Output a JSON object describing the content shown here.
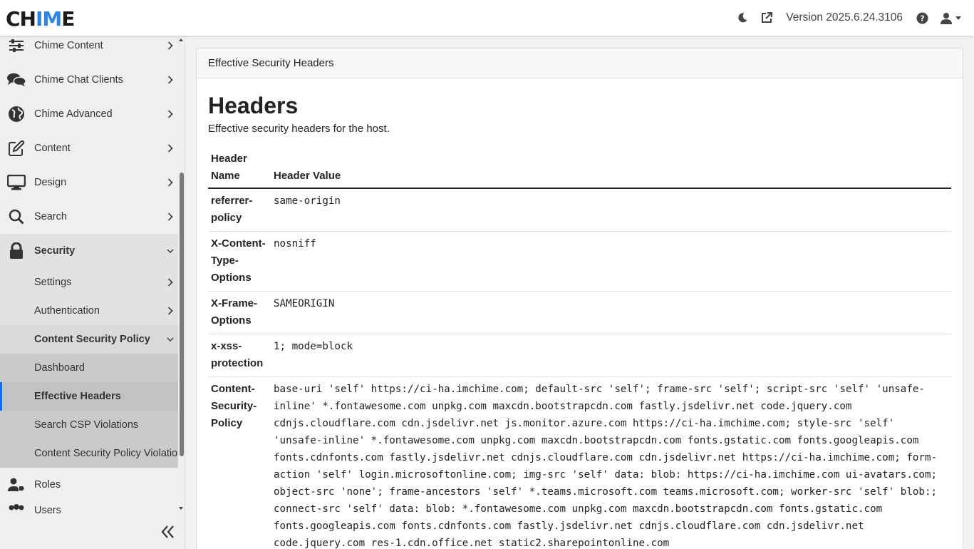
{
  "app": {
    "logo_text_1": "CH",
    "logo_text_accent": "IM",
    "logo_text_2": "E",
    "version": "Version 2025.6.24.3106",
    "icons": [
      "moon-icon",
      "external-link-icon",
      "question-icon",
      "user-icon"
    ]
  },
  "sidebar": {
    "items": [
      {
        "label": "Chime Content",
        "icon": "sliders-icon"
      },
      {
        "label": "Chime Chat Clients",
        "icon": "comments-icon"
      },
      {
        "label": "Chime Advanced",
        "icon": "globe-icon"
      },
      {
        "label": "Content",
        "icon": "edit-icon"
      },
      {
        "label": "Design",
        "icon": "desktop-icon"
      },
      {
        "label": "Search",
        "icon": "search-icon"
      },
      {
        "label": "Security",
        "icon": "lock-icon"
      },
      {
        "label": "Settings"
      },
      {
        "label": "Authentication"
      },
      {
        "label": "Content Security Policy"
      },
      {
        "label": "Dashboard"
      },
      {
        "label": "Effective Headers"
      },
      {
        "label": "Search CSP Violations"
      },
      {
        "label": "Content Security Policy Violation"
      },
      {
        "label": "Roles",
        "icon": "user-tag-icon"
      },
      {
        "label": "Users",
        "icon": "users-icon"
      }
    ]
  },
  "main": {
    "card_title": "Effective Security Headers",
    "heading": "Headers",
    "subtitle": "Effective security headers for the host.",
    "table": {
      "columns": [
        "Header Name",
        "Header Value"
      ],
      "rows": [
        {
          "name": "referrer-policy",
          "value": "same-origin"
        },
        {
          "name": "X-Content-Type-Options",
          "value": "nosniff"
        },
        {
          "name": "X-Frame-Options",
          "value": "SAMEORIGIN"
        },
        {
          "name": "x-xss-protection",
          "value": "1; mode=block"
        },
        {
          "name": "Content-Security-Policy",
          "value": "base-uri 'self' https://ci-ha.imchime.com; default-src 'self'; frame-src 'self'; script-src 'self' 'unsafe-inline' *.fontawesome.com unpkg.com maxcdn.bootstrapcdn.com fastly.jsdelivr.net code.jquery.com cdnjs.cloudflare.com cdn.jsdelivr.net js.monitor.azure.com https://ci-ha.imchime.com; style-src 'self' 'unsafe-inline' *.fontawesome.com unpkg.com maxcdn.bootstrapcdn.com fonts.gstatic.com fonts.googleapis.com fonts.cdnfonts.com fastly.jsdelivr.net cdnjs.cloudflare.com cdn.jsdelivr.net https://ci-ha.imchime.com; form-action 'self' login.microsoftonline.com; img-src 'self' data: blob: https://ci-ha.imchime.com ui-avatars.com; object-src 'none'; frame-ancestors 'self' *.teams.microsoft.com teams.microsoft.com; worker-src 'self' blob:; connect-src 'self' data: blob: *.fontawesome.com unpkg.com maxcdn.bootstrapcdn.com fonts.gstatic.com fonts.googleapis.com fonts.cdnfonts.com fastly.jsdelivr.net cdnjs.cloudflare.com cdn.jsdelivr.net code.jquery.com res-1.cdn.office.net static2.sharepointonline.com"
        }
      ]
    }
  }
}
